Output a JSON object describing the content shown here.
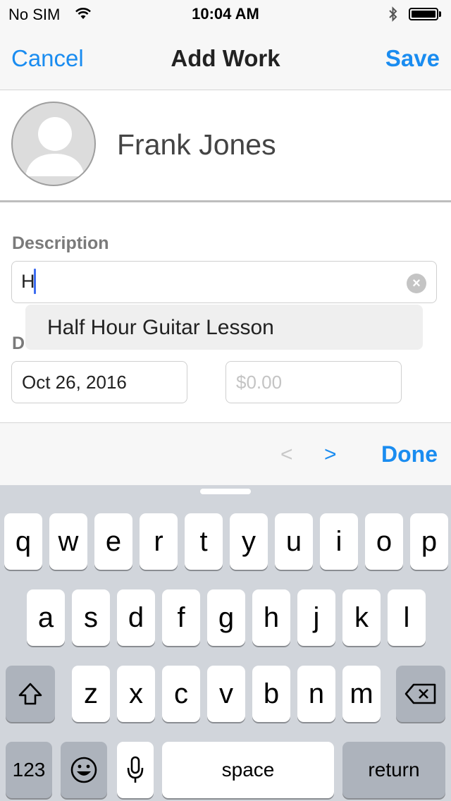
{
  "status_bar": {
    "carrier": "No SIM",
    "time": "10:04 AM"
  },
  "nav": {
    "cancel_label": "Cancel",
    "title": "Add Work",
    "save_label": "Save"
  },
  "client": {
    "name": "Frank Jones"
  },
  "form": {
    "description_label": "Description",
    "description_value": "H",
    "date_label": "D",
    "date_value": "Oct 26, 2016",
    "amount_placeholder": "$0.00",
    "suggestion": "Half Hour Guitar Lesson"
  },
  "accessory": {
    "prev": "<",
    "next": ">",
    "done_label": "Done"
  },
  "keyboard": {
    "row1": [
      "q",
      "w",
      "e",
      "r",
      "t",
      "y",
      "u",
      "i",
      "o",
      "p"
    ],
    "row2": [
      "a",
      "s",
      "d",
      "f",
      "g",
      "h",
      "j",
      "k",
      "l"
    ],
    "row3": [
      "z",
      "x",
      "c",
      "v",
      "b",
      "n",
      "m"
    ],
    "numbers_label": "123",
    "space_label": "space",
    "return_label": "return"
  },
  "colors": {
    "accent": "#1a8cf0",
    "caret": "#3d6cf0",
    "keyboard_bg": "#d1d5db",
    "function_key": "#adb3bc"
  }
}
